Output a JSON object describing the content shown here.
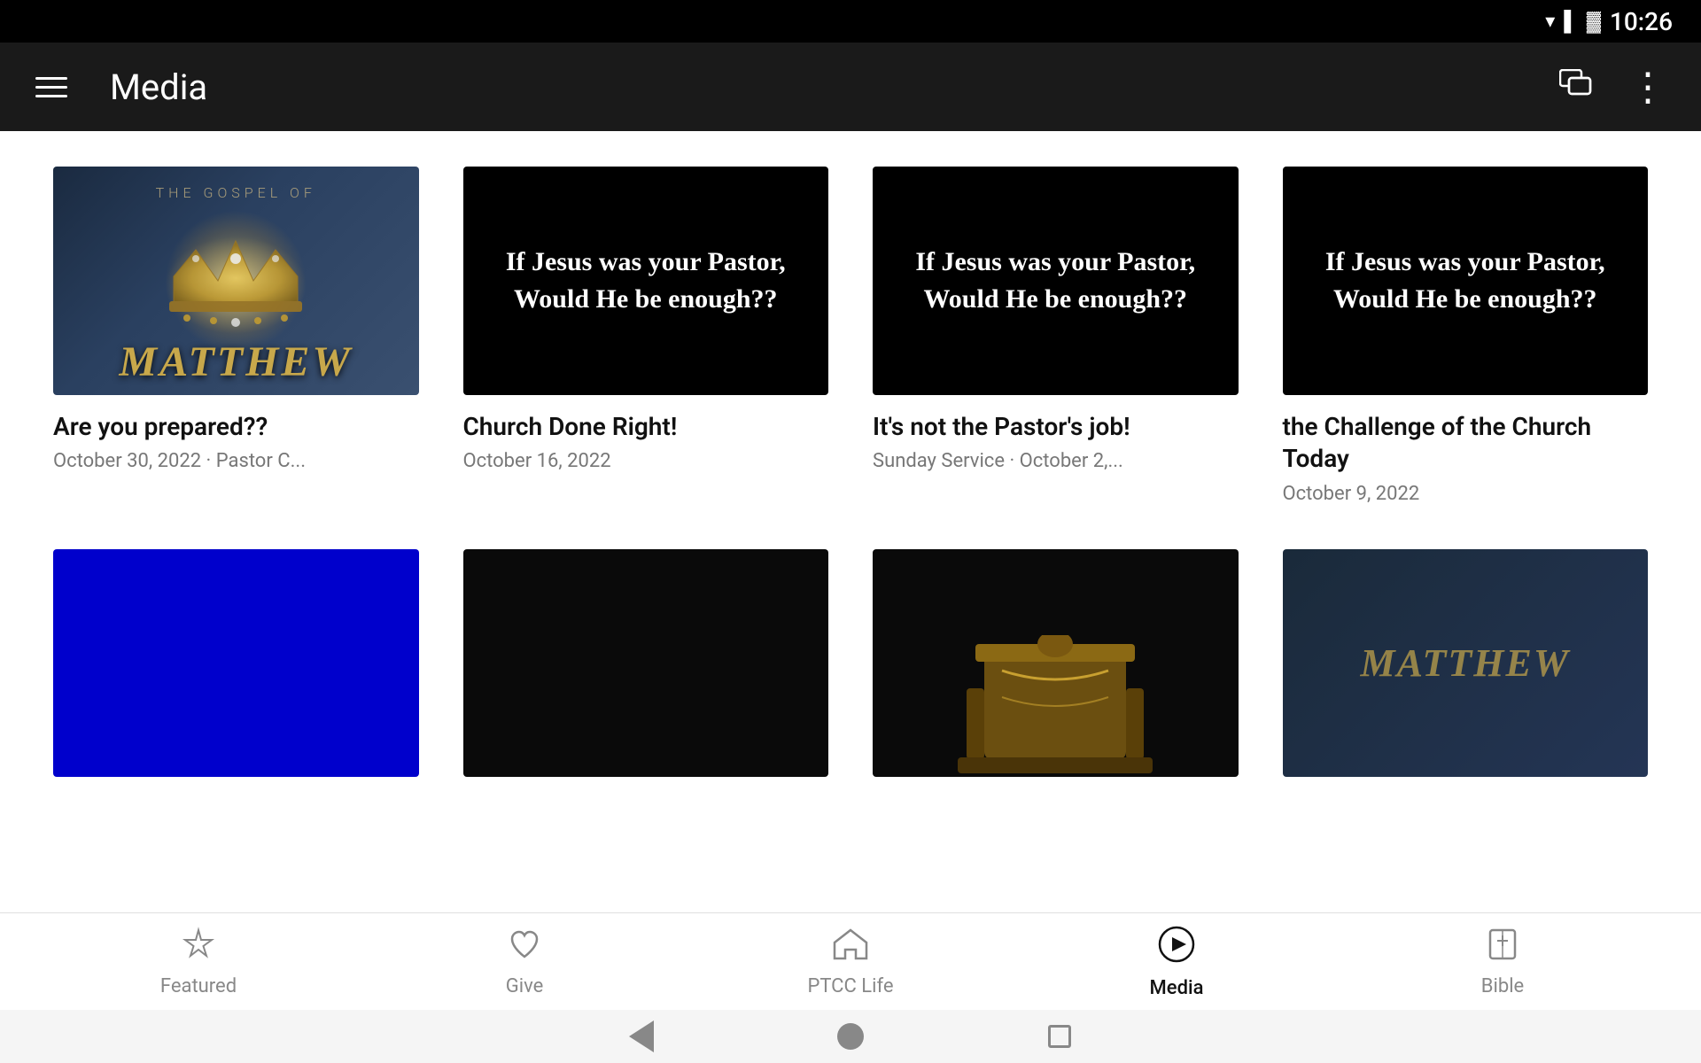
{
  "status_bar": {
    "time": "10:26"
  },
  "top_bar": {
    "title": "Media",
    "menu_icon": "≡",
    "chat_icon": "⬜",
    "more_icon": "⋮"
  },
  "media_cards": [
    {
      "id": "card-1",
      "thumb_type": "matthew",
      "title": "Are you prepared??",
      "subtitle": "October 30, 2022 · Pastor C..."
    },
    {
      "id": "card-2",
      "thumb_type": "jesus",
      "title": "Church Done Right!",
      "subtitle": "October 16, 2022"
    },
    {
      "id": "card-3",
      "thumb_type": "jesus",
      "title": "It's not the Pastor's job!",
      "subtitle": "Sunday Service · October 2,..."
    },
    {
      "id": "card-4",
      "thumb_type": "jesus",
      "title": "the Challenge of the Church Today",
      "subtitle": "October 9, 2022"
    },
    {
      "id": "card-5",
      "thumb_type": "blue",
      "title": "",
      "subtitle": ""
    },
    {
      "id": "card-6",
      "thumb_type": "black",
      "title": "",
      "subtitle": ""
    },
    {
      "id": "card-7",
      "thumb_type": "throne",
      "title": "",
      "subtitle": ""
    },
    {
      "id": "card-8",
      "thumb_type": "matthew2",
      "title": "",
      "subtitle": ""
    }
  ],
  "jesus_text": "If Jesus was your Pastor, Would He be enough??",
  "matthew_label": "THE GOSPEL OF",
  "matthew_main": "MATTHEW",
  "bottom_nav": {
    "items": [
      {
        "id": "featured",
        "label": "Featured",
        "icon": "◇",
        "active": false
      },
      {
        "id": "give",
        "label": "Give",
        "icon": "♡",
        "active": false
      },
      {
        "id": "ptcc-life",
        "label": "PTCC Life",
        "icon": "⌂",
        "active": false
      },
      {
        "id": "media",
        "label": "Media",
        "icon": "▶",
        "active": true
      },
      {
        "id": "bible",
        "label": "Bible",
        "icon": "⊞",
        "active": false
      }
    ]
  }
}
